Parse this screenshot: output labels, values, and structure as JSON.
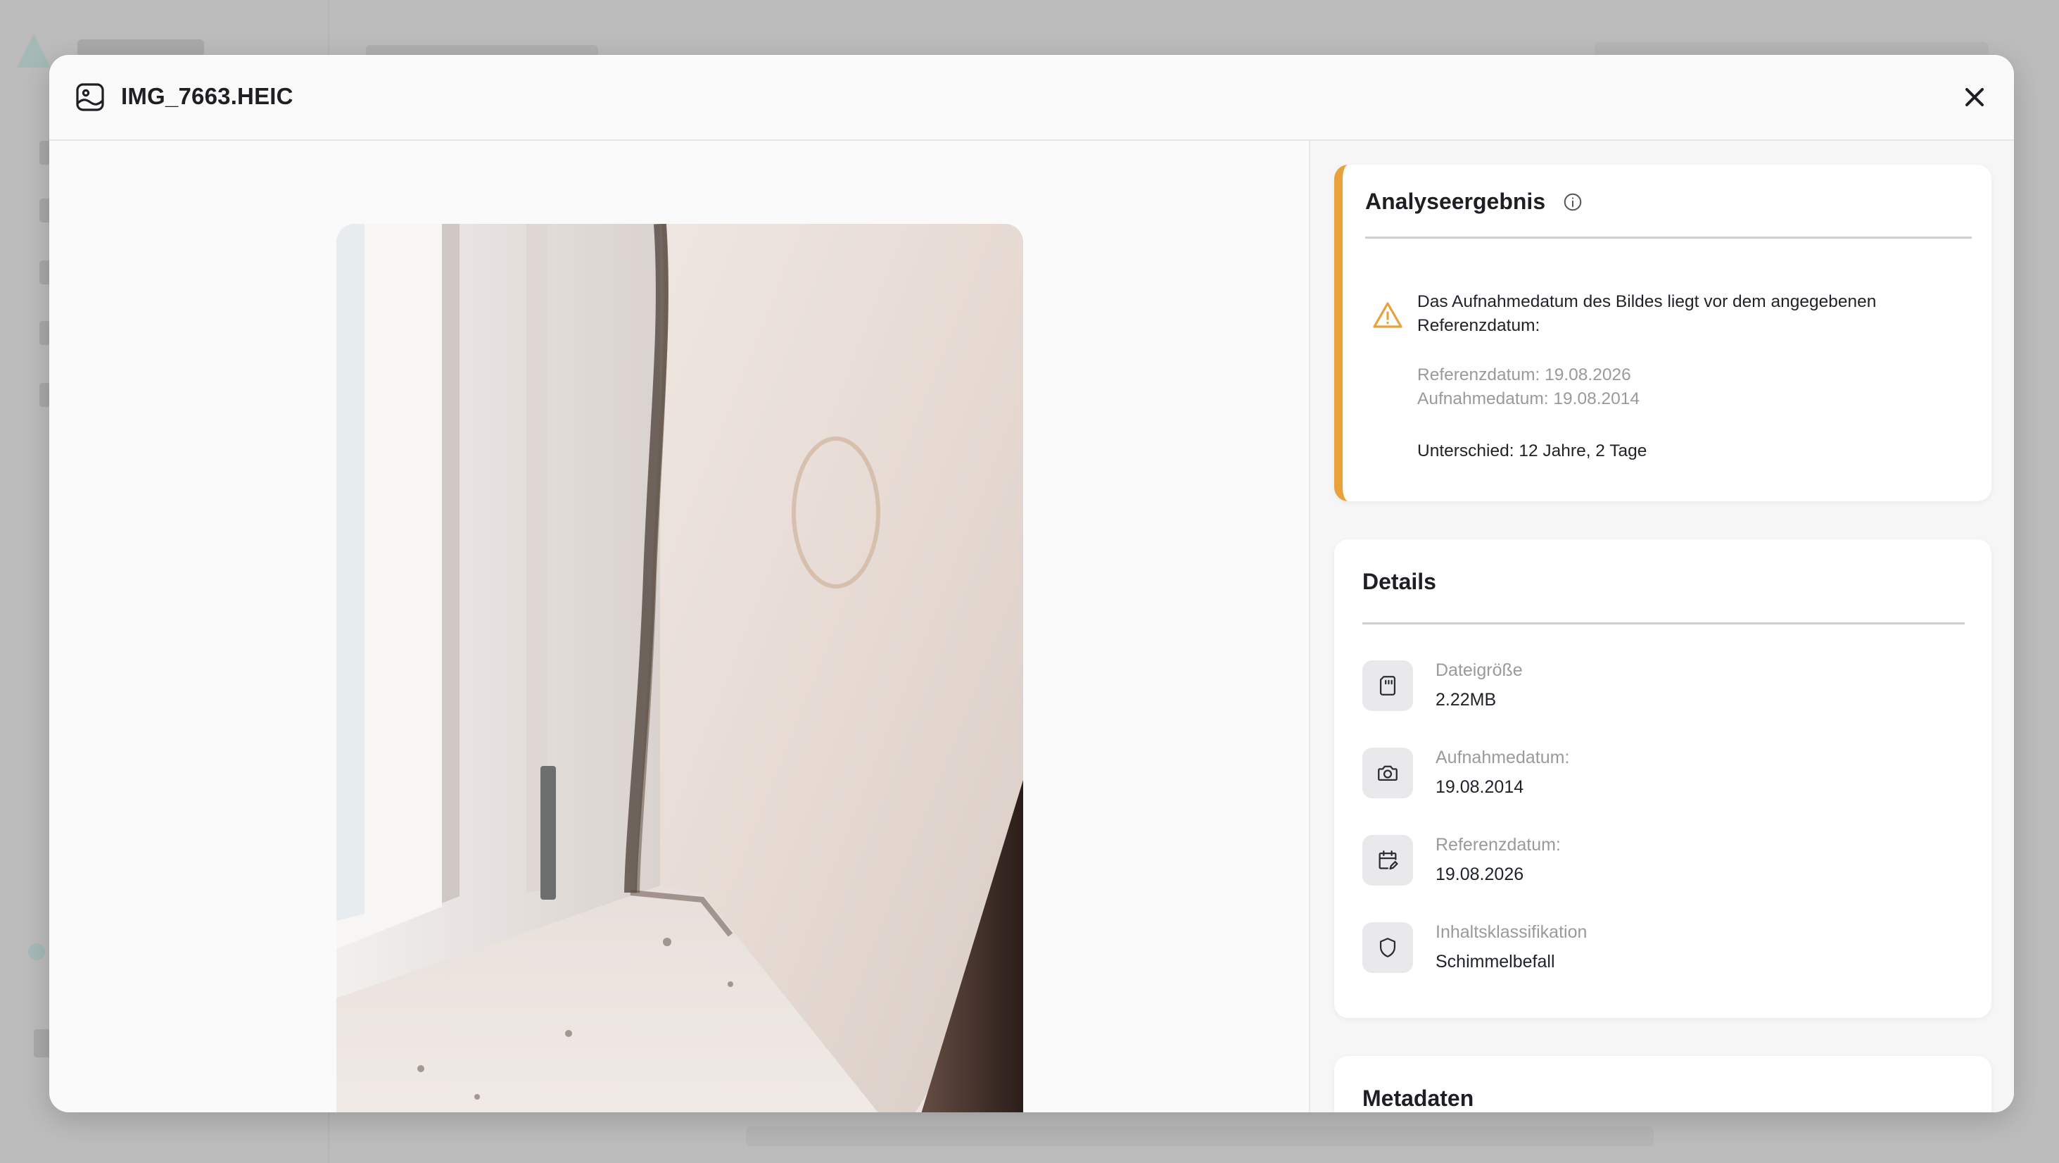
{
  "modal": {
    "file_name": "IMG_7663.HEIC",
    "close_label": "close"
  },
  "analysis": {
    "title": "Analyseergebnis",
    "warning_line1": "Das Aufnahmedatum des Bildes liegt vor dem angegebenen",
    "warning_line2": "Referenzdatum:",
    "reference_date_line": "Referenzdatum: 19.08.2026",
    "capture_date_line": "Aufnahmedatum: 19.08.2014",
    "difference_line": "Unterschied: 12 Jahre, 2 Tage",
    "accent_color": "#e9a13b"
  },
  "details": {
    "title": "Details",
    "rows": [
      {
        "icon": "sd-card-icon",
        "label": "Dateigröße",
        "value": "2.22MB"
      },
      {
        "icon": "camera-icon",
        "label": "Aufnahmedatum:",
        "value": "19.08.2014"
      },
      {
        "icon": "calendar-edit-icon",
        "label": "Referenzdatum:",
        "value": "19.08.2026"
      },
      {
        "icon": "shield-icon",
        "label": "Inhaltsklassifikation",
        "value": "Schimmelbefall"
      }
    ]
  },
  "metadata": {
    "title": "Metadaten"
  }
}
